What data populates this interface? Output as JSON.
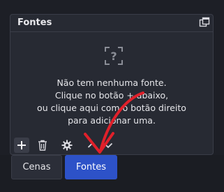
{
  "dock": {
    "title": "Fontes",
    "float_icon": "float-window-icon",
    "empty_icon": "unknown-source-icon",
    "empty_message": [
      "Não tem nenhuma fonte.",
      "Clique no botão + abaixo,",
      "ou clique aqui com o botão direito",
      "para adicionar uma."
    ],
    "toolbar": {
      "add_icon": "plus-icon",
      "remove_icon": "trash-icon",
      "properties_icon": "gear-icon",
      "move_up_icon": "chevron-up-icon",
      "move_down_icon": "chevron-down-icon"
    }
  },
  "tabs": [
    {
      "label": "Cenas",
      "active": false
    },
    {
      "label": "Fontes",
      "active": true
    }
  ],
  "colors": {
    "background": "#1d1f26",
    "panel": "#272a33",
    "active_tab": "#2d52c8",
    "annotation": "#e0202a"
  }
}
